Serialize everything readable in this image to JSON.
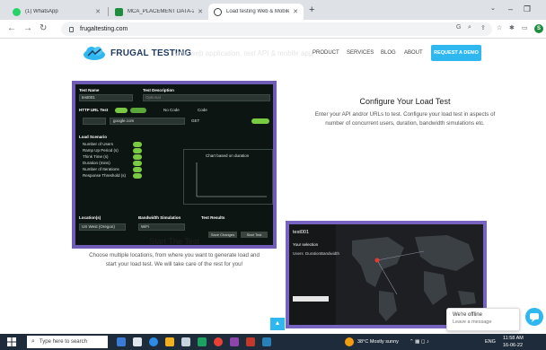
{
  "browser": {
    "tabs": [
      {
        "title": "(1) WhatsApp",
        "favicon_color": "#25d366"
      },
      {
        "title": "MCA_PLACEMENT DATA-2022-2",
        "favicon_color": "#1e8e3e"
      },
      {
        "title": "Load testing Web & Mobile app",
        "favicon_color": "#3c4043",
        "active": true
      }
    ],
    "new_tab": "+",
    "url": "frugaltesting.com",
    "profile_initial": "S"
  },
  "site": {
    "logo_text": "FRUGAL TESTING",
    "ghost_text": "your web application, rest API & mobile app",
    "nav": [
      "PRODUCT",
      "SERVICES",
      "BLOG",
      "ABOUT"
    ],
    "cta": "REQUEST A DEMO",
    "brand_color": "#2fb8f0"
  },
  "features": [
    {
      "title": "Configure Your Load Test",
      "description_lines": [
        "Enter your API and/or URLs to test. Configure your load test in aspects of",
        "number of concurrent users, duration, bandwidth simulations etc."
      ]
    },
    {
      "title": "Start The Test",
      "description_lines": [
        "Choose multiple locations, from where you want to generate load and",
        "start your load test. We will take care of the rest for you!"
      ]
    }
  ],
  "dashboard": {
    "test_name_label": "Test Name",
    "test_name_value": "test001",
    "description_label": "Test Description",
    "description_placeholder": "Optional",
    "http_label": "HTTP URL Test",
    "no_code": "No Code",
    "code": "Code",
    "method_value": "GET",
    "url_value": "google.com",
    "load_scenario_label": "Load Scenario",
    "load_rows": [
      "Number of Users",
      "Ramp Up Period (s)",
      "Think Time (s)",
      "Duration (mins)",
      "Number of Iterations",
      "Response Threshold (s)"
    ],
    "chart_label": "Chart based on duration",
    "locations_label": "Location(s)",
    "location_value": "US West (Oregon)",
    "bandwidth_label": "Bandwidth Simulation",
    "bandwidth_value": "WiFi",
    "results_label": "Test Results",
    "save_label": "Save Changes",
    "start_label": "Start Test"
  },
  "map": {
    "test_label": "test001",
    "your_selection": "Your selection",
    "columns": [
      "Users",
      "Duration",
      "Bandwidth"
    ]
  },
  "chat": {
    "status": "We're offline",
    "prompt": "Leave a message"
  },
  "taskbar": {
    "search_placeholder": "Type here to search",
    "weather": "38°C  Mostly sunny",
    "lang": "ENG",
    "time": "11:58 AM",
    "date": "16-06-22"
  }
}
